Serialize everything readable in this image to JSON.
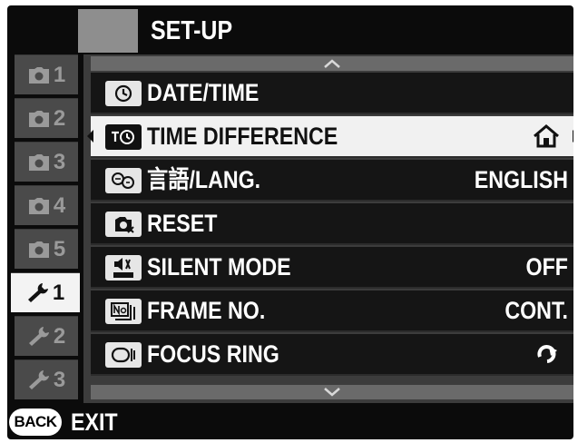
{
  "header": {
    "title": "SET-UP"
  },
  "tabs": [
    {
      "num": "1",
      "icon": "camera-icon",
      "active": false
    },
    {
      "num": "2",
      "icon": "camera-icon",
      "active": false
    },
    {
      "num": "3",
      "icon": "camera-icon",
      "active": false
    },
    {
      "num": "4",
      "icon": "camera-icon",
      "active": false
    },
    {
      "num": "5",
      "icon": "camera-icon",
      "active": false
    },
    {
      "num": "1",
      "icon": "wrench-icon",
      "active": true
    },
    {
      "num": "2",
      "icon": "wrench-icon",
      "active": false
    },
    {
      "num": "3",
      "icon": "wrench-icon",
      "active": false
    }
  ],
  "menu": {
    "items": [
      {
        "label": "DATE/TIME",
        "value": "",
        "icon": "clock-icon"
      },
      {
        "label": "TIME DIFFERENCE",
        "value": "",
        "icon": "time-difference-icon",
        "value_icon": "home-icon",
        "selected": true
      },
      {
        "label": "言語/LANG.",
        "value": "ENGLISH",
        "icon": "language-icon"
      },
      {
        "label": "RESET",
        "value": "",
        "icon": "reset-icon"
      },
      {
        "label": "SILENT MODE",
        "value": "OFF",
        "icon": "silent-mode-icon"
      },
      {
        "label": "FRAME NO.",
        "value": "CONT.",
        "icon": "frame-number-icon"
      },
      {
        "label": "FOCUS RING",
        "value": "",
        "icon": "focus-ring-icon",
        "value_icon": "clockwise-arrow-icon"
      }
    ]
  },
  "footer": {
    "back_label": "BACK",
    "exit_label": "EXIT"
  },
  "colors": {
    "background": "#0b0b0b",
    "row": "#151515",
    "selected_row": "#f1f1f1",
    "tab": "#4a4a4a",
    "active_tab": "#f3f3f3"
  }
}
